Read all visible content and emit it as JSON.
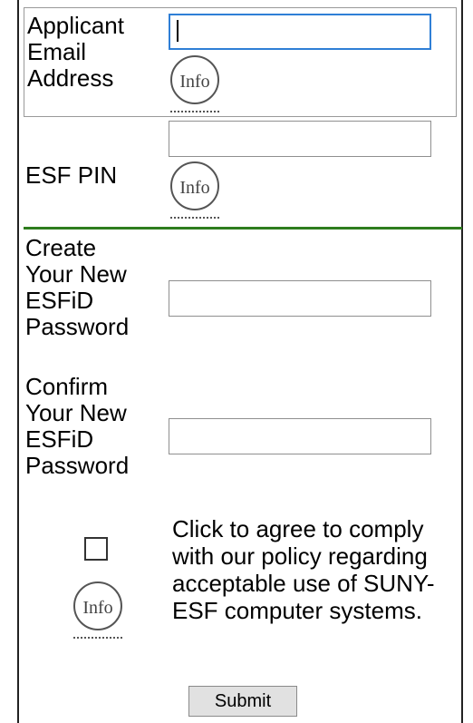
{
  "form": {
    "email": {
      "label": "Applicant\nEmail\nAddress",
      "value": "",
      "info_label": "Info"
    },
    "pin": {
      "label": "ESF PIN",
      "value": "",
      "info_label": "Info"
    },
    "new_password": {
      "label": "Create\nYour New\nESFiD\nPassword",
      "value": ""
    },
    "confirm_password": {
      "label": "Confirm\nYour New\nESFiD\nPassword",
      "value": ""
    },
    "agreement": {
      "checked": false,
      "text": "Click to agree to comply with our policy regarding acceptable use of SUNY-ESF computer systems.",
      "info_label": "Info"
    },
    "submit_label": "Submit"
  },
  "colors": {
    "divider": "#2e7d1e",
    "focus_border": "#2f7fd6"
  },
  "icons": {
    "info": "info-icon"
  }
}
